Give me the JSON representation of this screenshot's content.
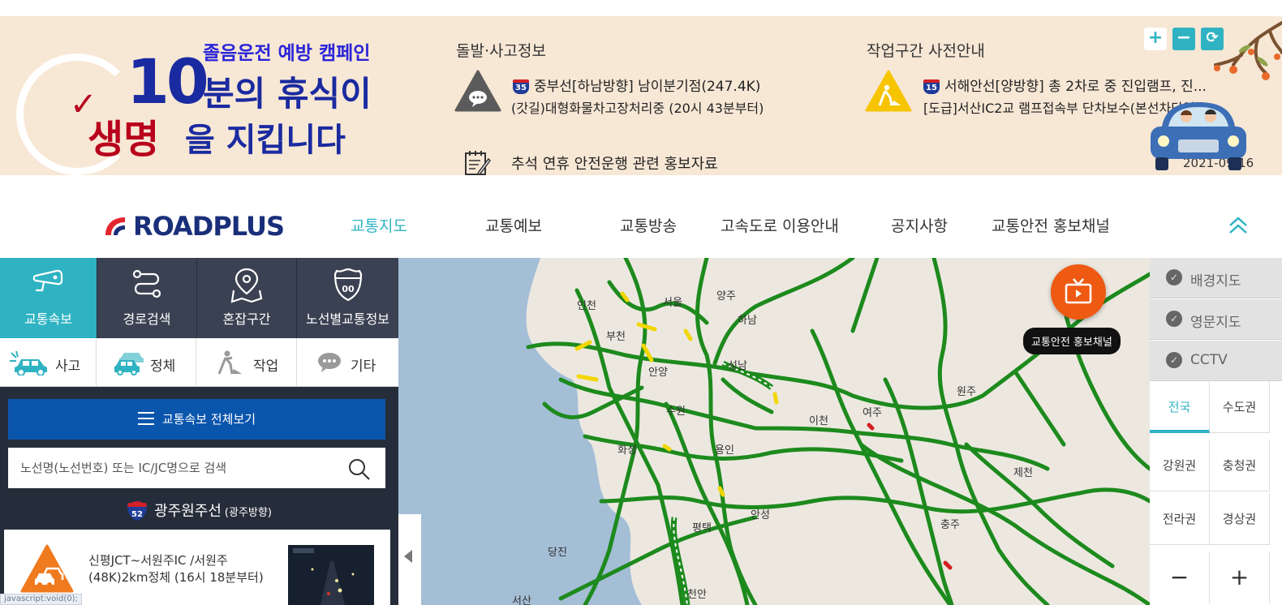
{
  "banner": {
    "campaign": {
      "subtitle": "졸음운전 예방 캠페인",
      "big_number": "10",
      "line1": "분의 휴식이",
      "line2_highlight": "생명",
      "line2_rest": "을 지킵니다"
    },
    "incident": {
      "title": "돌발·사고정보",
      "route_no": "35",
      "line1": "중부선[하남방향] 남이분기점(247.4K)",
      "line2": "(갓길)대형화물차고장처리중 (20시 43분부터)"
    },
    "roadwork": {
      "title": "작업구간 사전안내",
      "route_no": "15",
      "line1": "서해안선[양방향] 총 2차로 중 진입램프, 진...",
      "line2": "[도급]서산IC2교 램프접속부 단차보수(본선차단없음)"
    },
    "notice": {
      "text": "추석 연휴 안전운행 관련 홍보자료",
      "date": "2021-09-16"
    },
    "controls": {
      "plus": "+",
      "minus": "−",
      "refresh": "⟳"
    }
  },
  "nav": {
    "logo": "ROADPLUS",
    "items": [
      {
        "label": "교통지도"
      },
      {
        "label": "교통예보"
      },
      {
        "label": "교통방송"
      },
      {
        "label": "고속도로 이용안내"
      },
      {
        "label": "공지사항"
      },
      {
        "label": "교통안전 홍보채널"
      }
    ]
  },
  "side": {
    "tabs": [
      {
        "label": "교통속보",
        "icon": "cctv-icon"
      },
      {
        "label": "경로검색",
        "icon": "route-icon"
      },
      {
        "label": "혼잡구간",
        "icon": "map-pin-icon"
      },
      {
        "label": "노선별교통정보",
        "icon": "highway-shield-icon"
      }
    ],
    "filters": [
      {
        "label": "사고",
        "icon": "accident-icon"
      },
      {
        "label": "정체",
        "icon": "congestion-icon"
      },
      {
        "label": "작업",
        "icon": "roadwork-icon"
      },
      {
        "label": "기타",
        "icon": "chat-icon"
      }
    ],
    "all_button": "교통속보 전체보기",
    "search_placeholder": "노선명(노선번호) 또는 IC/JC명으로 검색",
    "route": {
      "no": "52",
      "name": "광주원주선",
      "direction": "(광주방향)"
    },
    "card": {
      "text": "신평JCT~서원주IC /서원주(48K)2km정체 (16시 18분부터)"
    }
  },
  "map": {
    "cities": [
      "인천",
      "서울",
      "양주",
      "하남",
      "부천",
      "안양",
      "성남",
      "원주",
      "여주",
      "이천",
      "수원",
      "용인",
      "화성",
      "제천",
      "안성",
      "평택",
      "충주",
      "당진",
      "천안",
      "서산"
    ],
    "promo_tooltip": "교통안전 홍보채널",
    "colors": {
      "road_green": "#1d8a1d",
      "road_yellow": "#f2d600",
      "road_red": "#d21f1f",
      "sea": "#a4bed6",
      "land": "#ece8e0"
    }
  },
  "rpanel": {
    "layers": [
      {
        "label": "배경지도"
      },
      {
        "label": "영문지도"
      },
      {
        "label": "CCTV"
      }
    ],
    "regions": [
      {
        "label": "전국"
      },
      {
        "label": "수도권"
      },
      {
        "label": "강원권"
      },
      {
        "label": "충청권"
      },
      {
        "label": "전라권"
      },
      {
        "label": "경상권"
      }
    ],
    "zoom_out": "−",
    "zoom_in": "+"
  },
  "status_bar": "javascript:void(0);"
}
